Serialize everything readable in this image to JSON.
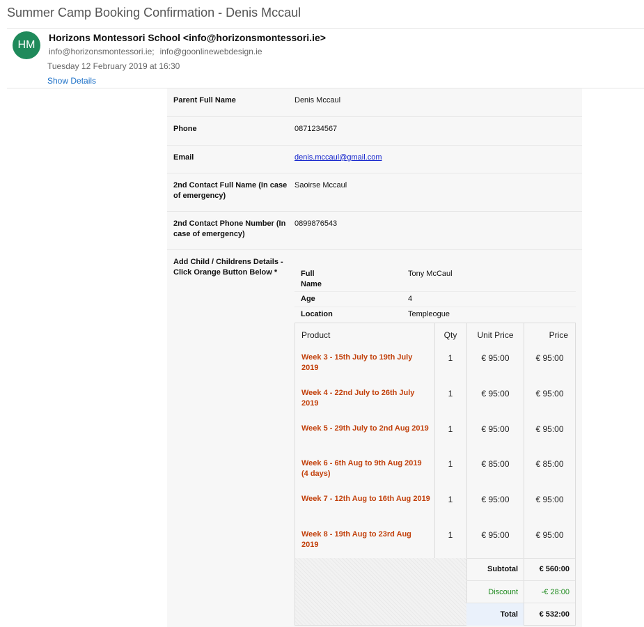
{
  "email": {
    "subject": "Summer Camp Booking Confirmation - Denis Mccaul",
    "avatar_initials": "HM",
    "avatar_color": "#1f8a5b",
    "sender": "Horizons Montessori School <info@horizonsmontessori.ie>",
    "recipients": [
      "info@horizonsmontessori.ie;",
      "info@goonlinewebdesign.ie"
    ],
    "date": "Tuesday 12 February 2019 at 16:30",
    "show_details": "Show Details"
  },
  "form": {
    "fields": [
      {
        "label": "Parent Full Name",
        "value": "Denis Mccaul"
      },
      {
        "label": "Phone",
        "value": "0871234567"
      },
      {
        "label": "Email",
        "value": "denis.mccaul@gmail.com"
      },
      {
        "label": "2nd Contact Full Name (In case of emergency)",
        "value": "Saoirse Mccaul"
      },
      {
        "label": "2nd Contact Phone Number (In case of emergency)",
        "value": "0899876543"
      },
      {
        "label": "Add Child / Childrens Details - Click Orange Button Below *",
        "value": ""
      }
    ],
    "child": {
      "rows": [
        {
          "label": "Full Name",
          "value": "Tony McCaul"
        },
        {
          "label": "Age",
          "value": "4"
        },
        {
          "label": "Location",
          "value": "Templeogue"
        }
      ]
    },
    "products": {
      "headers": {
        "product": "Product",
        "qty": "Qty",
        "unit_price": "Unit Price",
        "price": "Price"
      },
      "rows": [
        {
          "name": "Week 3 - 15th July to 19th July 2019",
          "qty": "1",
          "unit": "€ 95:00",
          "price": "€ 95:00"
        },
        {
          "name": "Week 4 - 22nd July to 26th July 2019",
          "qty": "1",
          "unit": "€ 95:00",
          "price": "€ 95:00"
        },
        {
          "name": "Week 5 - 29th July to 2nd Aug 2019",
          "qty": "1",
          "unit": "€ 95:00",
          "price": "€ 95:00"
        },
        {
          "name": "Week 6 - 6th Aug to 9th Aug 2019 (4 days)",
          "qty": "1",
          "unit": "€ 85:00",
          "price": "€ 85:00"
        },
        {
          "name": "Week 7 - 12th Aug to 16th Aug 2019",
          "qty": "1",
          "unit": "€ 95:00",
          "price": "€ 95:00"
        },
        {
          "name": "Week 8 - 19th Aug to 23rd Aug 2019",
          "qty": "1",
          "unit": "€ 95:00",
          "price": "€ 95:00"
        }
      ],
      "subtotal_label": "Subtotal",
      "subtotal": "€ 560:00",
      "discount_label": "Discount",
      "discount": "-€ 28:00",
      "total_label": "Total",
      "total": "€ 532:00"
    }
  },
  "colors": {
    "product_text": "#c2410c",
    "discount": "#1e8a1e",
    "link": "#1a6fc7",
    "total_row_bg": "#eaf1fb"
  }
}
